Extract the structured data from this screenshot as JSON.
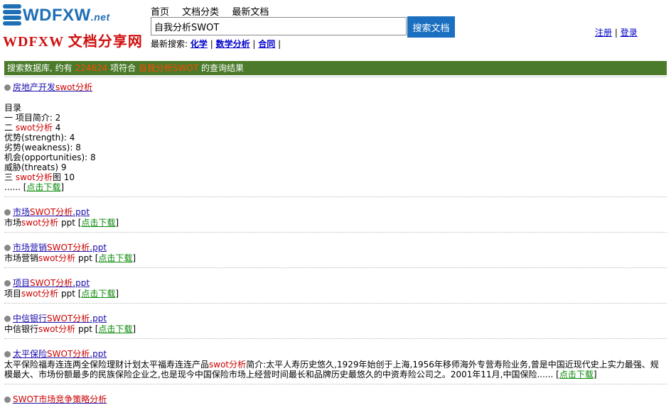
{
  "logo": {
    "en_main": "WDFXW",
    "en_suffix": ".net",
    "cn": "WDFXW 文档分享网"
  },
  "nav": [
    "首页",
    "文档分类",
    "最新文档"
  ],
  "search": {
    "value": "自我分析SWOT",
    "button": "搜索文档"
  },
  "recent": {
    "label": "最新搜索:",
    "items": [
      "化学",
      "数学分析",
      "合同"
    ]
  },
  "user": {
    "register": "注册",
    "login": "登录"
  },
  "resultbar": {
    "pre": "搜索数据库, 约有 ",
    "count": "224624",
    "mid": " 项符合 ",
    "query": "自我分析SWOT",
    "post": " 的查询结果"
  },
  "results": [
    {
      "title_pre": "房地产开发",
      "title_hl": "swot分析",
      "title_post": "",
      "lines": [
        [
          "",
          ""
        ],
        [
          "目录",
          ""
        ],
        [
          "一 项目简介: 2",
          ""
        ]
      ]
    },
    {
      "title_pre": "市场",
      "title_hl": "SWOT分析",
      "title_post": ".ppt",
      "snip_pre": "市场",
      "snip_hl": "swot分析",
      "snip_post": " ppt"
    },
    {
      "title_pre": "市场营销",
      "title_hl": "SWOT分析",
      "title_post": ".ppt",
      "snip_pre": "市场营销",
      "snip_hl": "swot分析",
      "snip_post": " ppt"
    },
    {
      "title_pre": "项目",
      "title_hl": "SWOT分析",
      "title_post": ".ppt",
      "snip_pre": "项目",
      "snip_hl": "swot分析",
      "snip_post": " ppt"
    },
    {
      "title_pre": "中信银行",
      "title_hl": "SWOT分析",
      "title_post": ".ppt",
      "snip_pre": "中信银行",
      "snip_hl": "swot分析",
      "snip_post": " ppt"
    },
    {
      "title_pre": "太平保险",
      "title_hl": "SWOT分析",
      "title_post": ".ppt",
      "snip_pre": "太平保险福寿连连两全保险理财计划太平福寿连连产品",
      "snip_hl": "swot分析",
      "snip_post": "简介:太平人寿历史悠久,1929年始创于上海,1956年移师海外专营寿险业务,曾是中国近现代史上实力最强、规模最大、市场份额最多的民族保险企业之,也是现今中国保险市场上经营时间最长和品牌历史最悠久的中资寿险公司之。2001年11月,中国保险......"
    },
    {
      "title_pre": "",
      "title_hl": "SWOT市场竞争策略分析",
      "title_post": ""
    }
  ],
  "first_toc": {
    "l1": "目录",
    "l2": "一 项目简介: 2",
    "l3_pre": "二 ",
    "l3_hl": "swot分析",
    "l3_post": " 4",
    "l4": "优势(strength): 4",
    "l5": "劣势(weakness): 8",
    "l6": "机会(opportunities): 8",
    "l7": "威胁(threats) 9",
    "l8_pre": "三 ",
    "l8_hl": "swot分析",
    "l8_post": "图 10",
    "l9": "......"
  },
  "download": "点击下载"
}
